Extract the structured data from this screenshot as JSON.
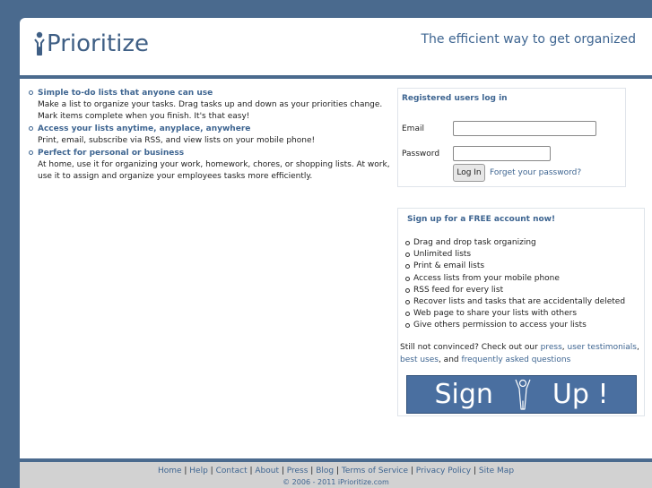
{
  "header": {
    "logo_text": "Prioritize",
    "tagline": "The efficient way to get organized"
  },
  "features": [
    {
      "title": "Simple to-do lists that anyone can use",
      "desc": "Make a list to organize your tasks. Drag tasks up and down as your priorities change. Mark items complete when you finish. It's that easy!"
    },
    {
      "title": "Access your lists anytime, anyplace, anywhere",
      "desc": "Print, email, subscribe via RSS, and view lists on your mobile phone!"
    },
    {
      "title": "Perfect for personal or business",
      "desc": "At home, use it for organizing your work, homework, chores, or shopping lists. At work, use it to assign and organize your employees tasks more efficiently."
    }
  ],
  "login": {
    "title": "Registered users log in",
    "email_label": "Email",
    "email_value": "",
    "password_label": "Password",
    "password_value": "",
    "login_button": "Log In",
    "forgot_link": "Forget your password?"
  },
  "signup": {
    "title": "Sign up for a FREE account now!",
    "benefits": [
      "Drag and drop task organizing",
      "Unlimited lists",
      "Print & email lists",
      "Access lists from your mobile phone",
      "RSS feed for every list",
      "Recover lists and tasks that are accidentally deleted",
      "Web page to share your lists with others",
      "Give others permission to access your lists"
    ],
    "convince_prefix": "Still not convinced? Check out our ",
    "link_press": "press",
    "sep1": ", ",
    "link_testimonials": "user testimonials",
    "sep2": ",",
    "link_best_uses": "best uses",
    "sep3": ", and ",
    "link_faq": "frequently asked questions",
    "button_word1": "Sign",
    "button_word2": "Up !"
  },
  "footer": {
    "links": [
      "Home",
      "Help",
      "Contact",
      "About",
      "Press",
      "Blog",
      "Terms of Service",
      "Privacy Policy",
      "Site Map"
    ],
    "separator": " | ",
    "copyright": "© 2006 - 2011 iPrioritize.com"
  },
  "colors": {
    "background": "#4a6a8e",
    "accent": "#3e6591",
    "signup_button": "#4a6fa0",
    "footer_bg": "#d2d2d2"
  },
  "icons": {
    "logo_figure": "person-arms-up-icon",
    "signup_figure": "person-arms-up-icon"
  }
}
